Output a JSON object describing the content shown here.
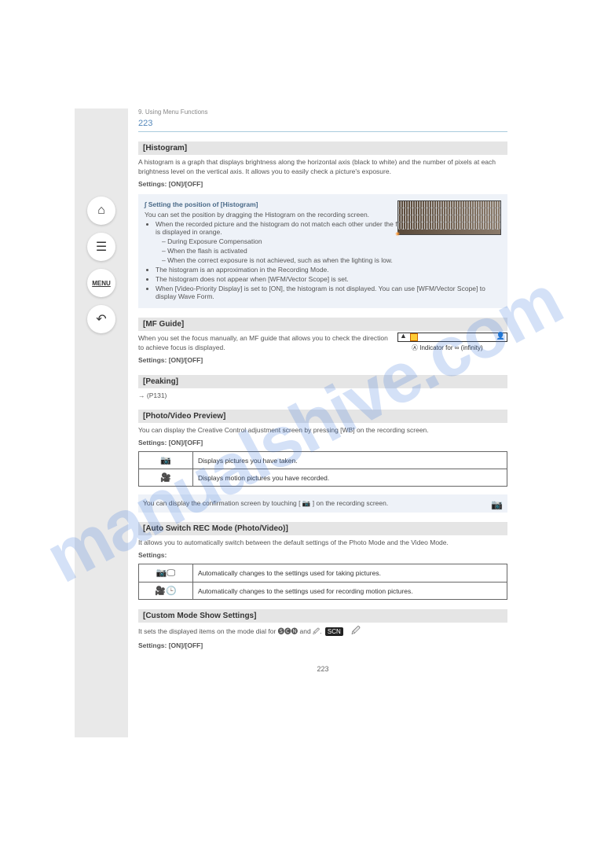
{
  "watermark": "manualshive.com",
  "sidebar": {
    "home": "⌂",
    "list": "☰",
    "menu": "MENU",
    "back": "↶"
  },
  "breadcrumb": "9. Using Menu Functions",
  "page_title": "223",
  "sections": {
    "histogram": {
      "title": "[Histogram]",
      "body": "A histogram is a graph that displays brightness along the horizontal axis (black to white) and the number of pixels at each brightness level on the vertical axis. It allows you to easily check a picture's exposure.",
      "settings": "Settings: [ON]/[OFF]",
      "info_title": "∫ Setting the position of [Histogram]",
      "info_body": "You can set the position by dragging the Histogram on the recording screen.",
      "info_items": [
        "When the recorded picture and the histogram do not match each other under the following conditions, the histogram is displayed in orange.",
        "– During Exposure Compensation",
        "– When the flash is activated",
        "– When the correct exposure is not achieved, such as when the lighting is low.",
        "The histogram is an approximation in the Recording Mode.",
        "The histogram does not appear when [WFM/Vector Scope] is set.",
        "When [Video-Priority Display] is set to [ON], the histogram is not displayed. You can use [WFM/Vector Scope] to display Wave Form."
      ]
    },
    "mfguide": {
      "title": "[MF Guide]",
      "body": "When you set the focus manually, an MF guide that allows you to check the direction to achieve focus is displayed.",
      "annot_a": "Ⓐ",
      "annot_label": "Indicator for ∞ (infinity)",
      "settings": "Settings: [ON]/[OFF]"
    },
    "peaking": {
      "title": "[Peaking]",
      "body": "→ (P131)"
    },
    "displaymode": {
      "title": "[Photo/Video Preview]",
      "body": "You can display the Creative Control adjustment screen by pressing [WB] on the recording screen.",
      "settings": "Settings: [ON]/[OFF]",
      "row1_icon": "📷",
      "row1_text": "Displays pictures you have taken.",
      "row2_icon": "🎥",
      "row2_text": "Displays motion pictures you have recorded."
    },
    "confirm": {
      "info_body": "You can display the confirmation screen by touching [  📷  ] on the recording screen."
    },
    "autooff": {
      "title": "[Auto Switch REC Mode (Photo/Video)]",
      "body": "It allows you to automatically switch between the default settings of the Photo Mode and the Video Mode.",
      "settings": "Settings:",
      "row1_icon": "📷🖵",
      "row1_text": "Automatically changes to the settings used for taking pictures.",
      "row2_icon": "🎥🕒",
      "row2_text": "Automatically changes to the settings used for recording motion pictures."
    },
    "customdial": {
      "title": "[Custom Mode Show Settings]",
      "body": "It sets the displayed items on the mode dial for 🅢🅒🅝 and 🖉.",
      "settings": "Settings: [ON]/[OFF]"
    }
  },
  "page_number": "223"
}
